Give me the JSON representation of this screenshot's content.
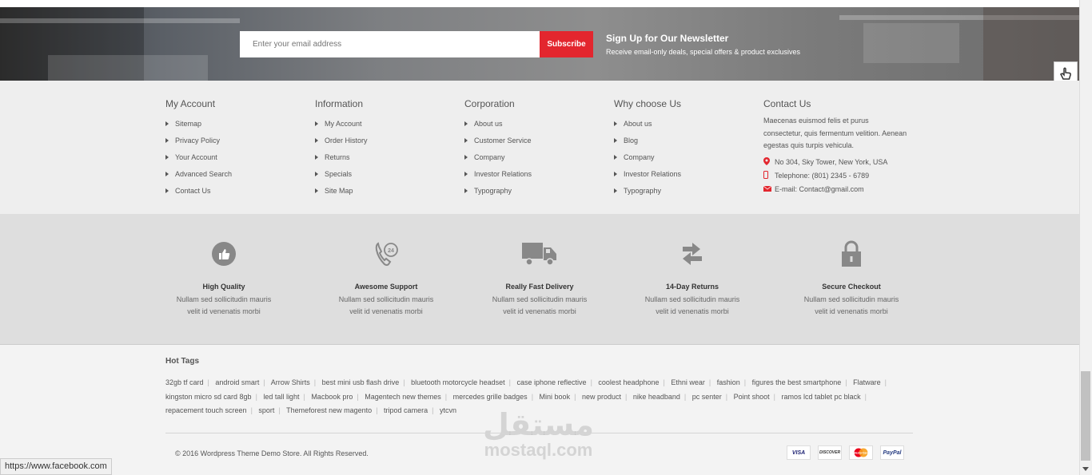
{
  "newsletter": {
    "email_placeholder": "Enter your email address",
    "subscribe_label": "Subscribe",
    "title": "Sign Up for Our Newsletter",
    "subtitle": "Receive email-only deals, special offers & product exclusives"
  },
  "footer": {
    "columns": [
      {
        "title": "My Account",
        "items": [
          "Sitemap",
          "Privacy Policy",
          "Your Account",
          "Advanced Search",
          "Contact Us"
        ]
      },
      {
        "title": "Information",
        "items": [
          "My Account",
          "Order History",
          "Returns",
          "Specials",
          "Site Map"
        ]
      },
      {
        "title": "Corporation",
        "items": [
          "About us",
          "Customer Service",
          "Company",
          "Investor Relations",
          "Typography"
        ]
      },
      {
        "title": "Why choose Us",
        "items": [
          "About us",
          "Blog",
          "Company",
          "Investor Relations",
          "Typography"
        ]
      }
    ],
    "contact": {
      "title": "Contact Us",
      "text": "Maecenas euismod felis et purus consectetur, quis fermentum velition. Aenean egestas quis turpis vehicula.",
      "address": "No 304, Sky Tower, New York, USA",
      "telephone": "Telephone: (801) 2345 - 6789",
      "email": "E-mail: Contact@gmail.com",
      "icon_color": "#e3262e"
    }
  },
  "features": [
    {
      "icon": "thumbs-up-icon",
      "title": "High Quality",
      "desc1": "Nullam sed sollicitudin mauris",
      "desc2": "velit id venenatis morbi"
    },
    {
      "icon": "support-24-icon",
      "title": "Awesome Support",
      "desc1": "Nullam sed sollicitudin mauris",
      "desc2": "velit id venenatis morbi"
    },
    {
      "icon": "truck-icon",
      "title": "Really Fast Delivery",
      "desc1": "Nullam sed sollicitudin mauris",
      "desc2": "velit id venenatis morbi"
    },
    {
      "icon": "exchange-arrows-icon",
      "title": "14-Day Returns",
      "desc1": "Nullam sed sollicitudin mauris",
      "desc2": "velit id venenatis morbi"
    },
    {
      "icon": "lock-icon",
      "title": "Secure Checkout",
      "desc1": "Nullam sed sollicitudin mauris",
      "desc2": "velit id venenatis morbi"
    }
  ],
  "hot_tags": {
    "title": "Hot Tags",
    "tags": [
      "32gb tf card",
      "android smart",
      "Arrow Shirts",
      "best mini usb flash drive",
      "bluetooth motorcycle headset",
      "case iphone reflective",
      "coolest headphone",
      "Ethni wear",
      "fashion",
      "figures the best smartphone",
      "Flatware",
      "kingston micro sd card 8gb",
      "led tall light",
      "Macbook pro",
      "Magentech new themes",
      "mercedes grille badges",
      "Mini book",
      "new product",
      "nike headband",
      "pc senter",
      "Point shoot",
      "ramos lcd tablet pc black",
      "repacement touch screen",
      "sport",
      "Themeforest new magento",
      "tripod camera",
      "ytcvn"
    ]
  },
  "copyright": "© 2016 Wordpress Theme Demo Store. All Rights Reserved.",
  "payments": [
    "VISA",
    "DISCOVER",
    "MasterCard",
    "PayPal"
  ],
  "watermark": {
    "arabic": "مستقل",
    "latin": "mostaql.com"
  },
  "status_url": "https://www.facebook.com",
  "colors": {
    "accent": "#e3262e"
  }
}
